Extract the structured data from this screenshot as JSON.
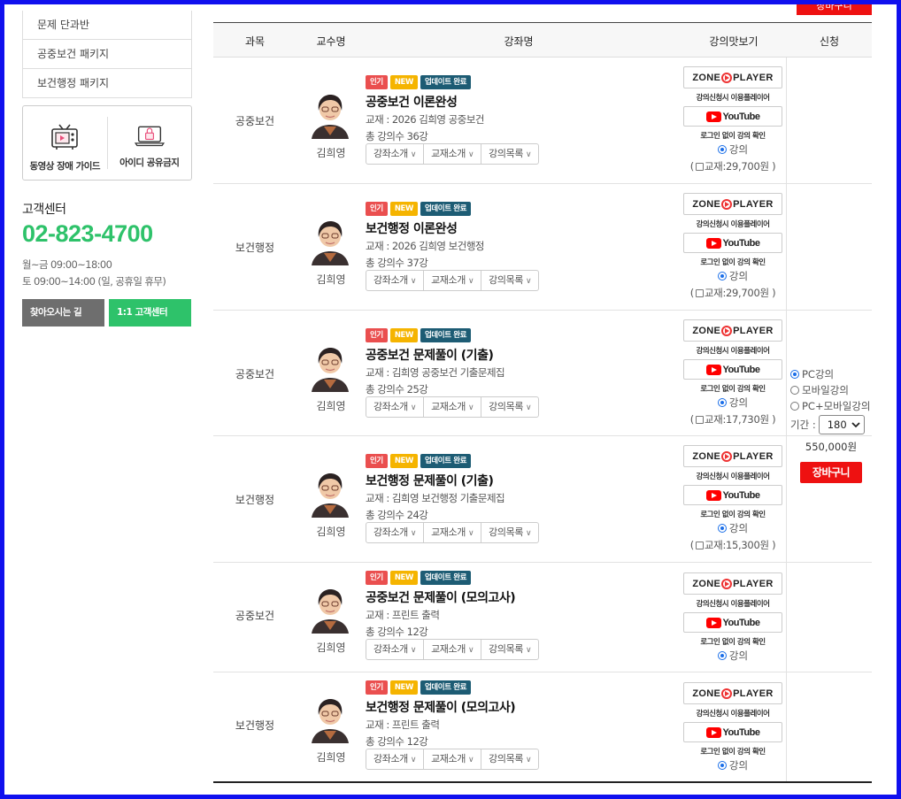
{
  "sidebar": {
    "menu": [
      "문제 단과반",
      "공중보건 패키지",
      "보건행정 패키지"
    ],
    "guides": [
      {
        "label": "동영상 장애 가이드",
        "icon": "tv-icon"
      },
      {
        "label": "아이디 공유금지",
        "icon": "laptop-lock-icon"
      }
    ],
    "cs_title": "고객센터",
    "cs_phone": "02-823-4700",
    "cs_hours_1": "월~금 09:00~18:00",
    "cs_hours_2": "토 09:00~14:00 (일, 공휴일 휴무)",
    "btn_directions": "찾아오시는 길",
    "btn_support": "1:1 고객센터"
  },
  "top_cart_label": "장바구니",
  "table": {
    "headers": {
      "subject": "과목",
      "professor": "교수명",
      "course": "강좌명",
      "preview": "강의맛보기",
      "apply": "신청"
    },
    "badges": {
      "hot": "인기",
      "new": "NEW",
      "updated": "업데이트 완료"
    },
    "dropdowns": [
      "강좌소개",
      "교재소개",
      "강의목록"
    ],
    "preview": {
      "zone_player": "ZONE PLAYER",
      "zone_note": "강의신청시 이용플레이어",
      "youtube": "YouTube",
      "youtube_note": "로그인 없이 강의 확인",
      "lecture_radio": "강의"
    },
    "rows": [
      {
        "subject": "공중보건",
        "professor": "김희영",
        "title": "공중보건 이론완성",
        "book": "교재 : 2026 김희영 공중보건",
        "count": "총 강의수 36강",
        "book_price": "교재:29,700원 )"
      },
      {
        "subject": "보건행정",
        "professor": "김희영",
        "title": "보건행정 이론완성",
        "book": "교재 : 2026 김희영 보건행정",
        "count": "총 강의수 37강",
        "book_price": "교재:29,700원 )"
      },
      {
        "subject": "공중보건",
        "professor": "김희영",
        "title": "공중보건 문제풀이 (기출)",
        "book": "교재 : 김희영 공중보건 기출문제집",
        "count": "총 강의수 25강",
        "book_price": "교재:17,730원 )"
      },
      {
        "subject": "보건행정",
        "professor": "김희영",
        "title": "보건행정 문제풀이 (기출)",
        "book": "교재 : 김희영 보건행정 기출문제집",
        "count": "총 강의수 24강",
        "book_price": "교재:15,300원 )"
      },
      {
        "subject": "공중보건",
        "professor": "김희영",
        "title": "공중보건 문제풀이 (모의고사)",
        "book": "교재 : 프린트 출력",
        "count": "총 강의수 12강",
        "book_price": ""
      },
      {
        "subject": "보건행정",
        "professor": "김희영",
        "title": "보건행정 문제풀이 (모의고사)",
        "book": "교재 : 프린트 출력",
        "count": "총 강의수 12강",
        "book_price": ""
      }
    ],
    "apply": {
      "opt_pc": "PC강의",
      "opt_mobile": "모바일강의",
      "opt_both": "PC+모바일강의",
      "period_label": "기간 :",
      "period_value": "180",
      "price": "550,000원",
      "cart": "장바구니"
    }
  },
  "colors": {
    "accent_green": "#2ec26a",
    "cart_red": "#ee1111",
    "badge_hot": "#ea4f4f",
    "badge_new": "#f5b400",
    "badge_update": "#1d5c74",
    "frame_blue": "#1010ee"
  }
}
